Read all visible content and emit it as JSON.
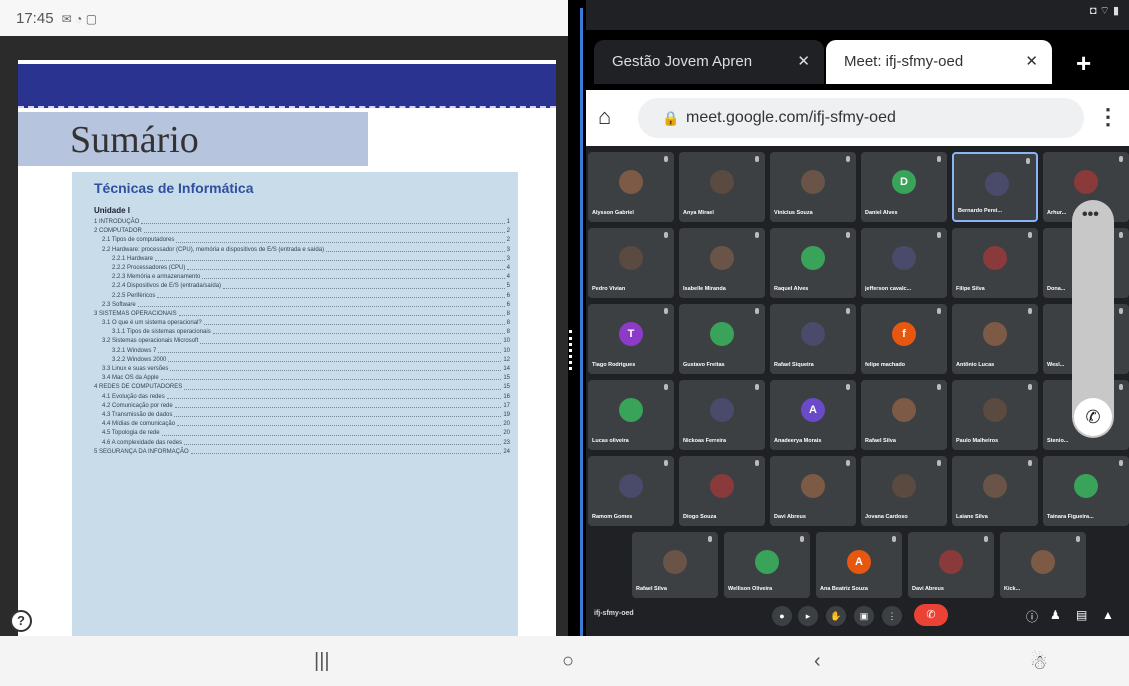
{
  "status": {
    "time": "17:45",
    "icons_left": "✉ ◔ ▢",
    "icons_right": "◘ ⌔ ▮"
  },
  "doc": {
    "title": "Sumário",
    "toc_title": "Técnicas de Informática",
    "unit": "Unidade I",
    "lines": [
      {
        "t": "1 INTRODUÇÃO",
        "p": "1",
        "lv": 1
      },
      {
        "t": "2 COMPUTADOR",
        "p": "2",
        "lv": 1
      },
      {
        "t": "2.1 Tipos de computadores",
        "p": "2",
        "lv": 2
      },
      {
        "t": "2.2 Hardware: processador (CPU), memória e dispositivos de E/S (entrada e saída)",
        "p": "3",
        "lv": 2
      },
      {
        "t": "2.2.1 Hardware",
        "p": "3",
        "lv": 3
      },
      {
        "t": "2.2.2 Processadores (CPU)",
        "p": "4",
        "lv": 3
      },
      {
        "t": "2.2.3 Memória e armazenamento",
        "p": "4",
        "lv": 3
      },
      {
        "t": "2.2.4 Dispositivos de E/S (entrada/saída)",
        "p": "5",
        "lv": 3
      },
      {
        "t": "2.2.5 Periféricos",
        "p": "6",
        "lv": 3
      },
      {
        "t": "2.3 Software",
        "p": "6",
        "lv": 2
      },
      {
        "t": "3 SISTEMAS OPERACIONAIS",
        "p": "8",
        "lv": 1
      },
      {
        "t": "3.1 O que é um sistema operacional?",
        "p": "8",
        "lv": 2
      },
      {
        "t": "3.1.1 Tipos de sistemas operacionais",
        "p": "8",
        "lv": 3
      },
      {
        "t": "3.2 Sistemas operacionais Microsoft",
        "p": "10",
        "lv": 2
      },
      {
        "t": "3.2.1 Windows 7",
        "p": "10",
        "lv": 3
      },
      {
        "t": "3.2.2 Windows 2000",
        "p": "12",
        "lv": 3
      },
      {
        "t": "3.3 Linux e suas versões",
        "p": "14",
        "lv": 2
      },
      {
        "t": "3.4 Mac OS da Apple",
        "p": "15",
        "lv": 2
      },
      {
        "t": "4 REDES DE COMPUTADORES",
        "p": "15",
        "lv": 1
      },
      {
        "t": "4.1 Evolução das redes",
        "p": "16",
        "lv": 2
      },
      {
        "t": "4.2 Comunicação por rede",
        "p": "17",
        "lv": 2
      },
      {
        "t": "4.3 Transmissão de dados",
        "p": "19",
        "lv": 2
      },
      {
        "t": "4.4 Mídias de comunicação",
        "p": "20",
        "lv": 2
      },
      {
        "t": "4.5 Topologia de rede",
        "p": "20",
        "lv": 2
      },
      {
        "t": "4.6 A complexidade das redes",
        "p": "23",
        "lv": 2
      },
      {
        "t": "5 SEGURANÇA DA INFORMAÇÃO",
        "p": "24",
        "lv": 1
      }
    ]
  },
  "browser": {
    "tab1": "Gestão Jovem Apren",
    "tab2": "Meet: ifj-sfmy-oed",
    "url": "meet.google.com/ifj-sfmy-oed"
  },
  "meet": {
    "code": "ifj-sfmy-oed",
    "rows": [
      [
        "Alysson Gabriel",
        "Anya Mirael",
        "Vinicius Souza",
        "Daniel Alves",
        "Bernardo Perei...",
        "Arhur..."
      ],
      [
        "Pedro Vivian",
        "Isabelle Miranda",
        "Raquel Alves",
        "jefferson cavalc...",
        "Filipe Silva",
        "Dona..."
      ],
      [
        "Tiago Rodrigues",
        "Gustavo Freitas",
        "Rafael Siqueira",
        "felipe machado",
        "Antônio Lucas",
        "Wesl..."
      ],
      [
        "Lucas oliveira",
        "Nickoas Ferreira",
        "Anadeerya Morais",
        "Rafael Silva",
        "Paulo Malheiros",
        "Stenio..."
      ],
      [
        "Ramom Gomes",
        "Diogo Souza",
        "Davi Abreus",
        "Jovana Cardoso",
        "Laiane Silva",
        "Tainara Figueira..."
      ]
    ],
    "last_row": [
      "Rafael Silva",
      "Wellison Oliveira",
      "Ana Beatriz Souza",
      "Davi Abreus",
      "Kick..."
    ]
  }
}
